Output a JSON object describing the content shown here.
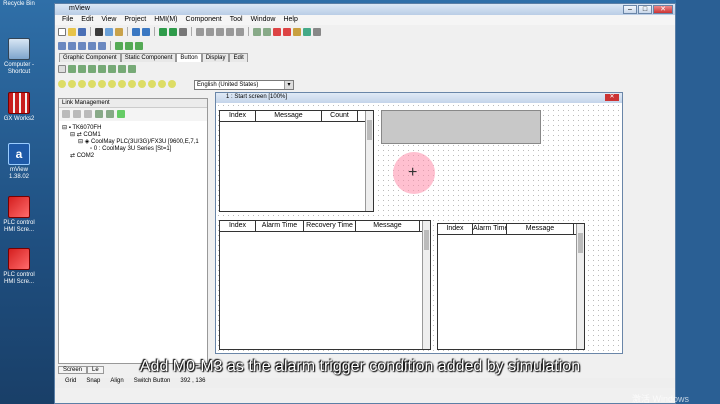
{
  "desktop": {
    "icons": [
      {
        "label": "Recycle Bin",
        "icon": "recycle-bin-icon"
      },
      {
        "label": "Computer - Shortcut",
        "icon": "computer-icon"
      },
      {
        "label": "GX Works2",
        "icon": "gxworks-icon"
      },
      {
        "label": "mView 1.38.02",
        "icon": "mview-icon"
      },
      {
        "label": "PLC control HMI Scre...",
        "icon": "plc-icon"
      },
      {
        "label": "PLC control HMI Scre...",
        "icon": "plc-icon"
      }
    ]
  },
  "window": {
    "title": "mView",
    "menu": [
      "File",
      "Edit",
      "View",
      "Project",
      "HMI(M)",
      "Component",
      "Tool",
      "Window",
      "Help"
    ],
    "component_tabs": [
      "Graphic Component",
      "Static Component",
      "Button",
      "Display",
      "Edit"
    ],
    "language": "English (United States)"
  },
  "link_panel": {
    "title": "Link Management",
    "tree": [
      "TK6070FH",
      "COM1",
      "CoolMay PLC(3U/3G)/FX3U [9600,E,7,1",
      "0 : CoolMay 3U Series [St=1]",
      "COM2"
    ]
  },
  "editor": {
    "title": "1 : Start screen [100%]",
    "table1_headers": [
      "Index",
      "Message",
      "Count"
    ],
    "table2_headers": [
      "Index",
      "Alarm Time",
      "Recovery Time",
      "Message"
    ],
    "table3_headers": [
      "Index",
      "Alarm Time",
      "Message"
    ]
  },
  "bottom_tabs": [
    "Screen",
    "Le"
  ],
  "status": [
    "Grid",
    "Snap",
    "Align",
    "Switch Button",
    "392 , 136"
  ],
  "subtitle": "Add M0-M3 as the alarm trigger condition added by simulation",
  "watermark": "激活 Windows",
  "colors": {
    "title_bar": "#c4d4ea",
    "desktop": "#2f6fa8",
    "highlight": "#ff8caa"
  }
}
